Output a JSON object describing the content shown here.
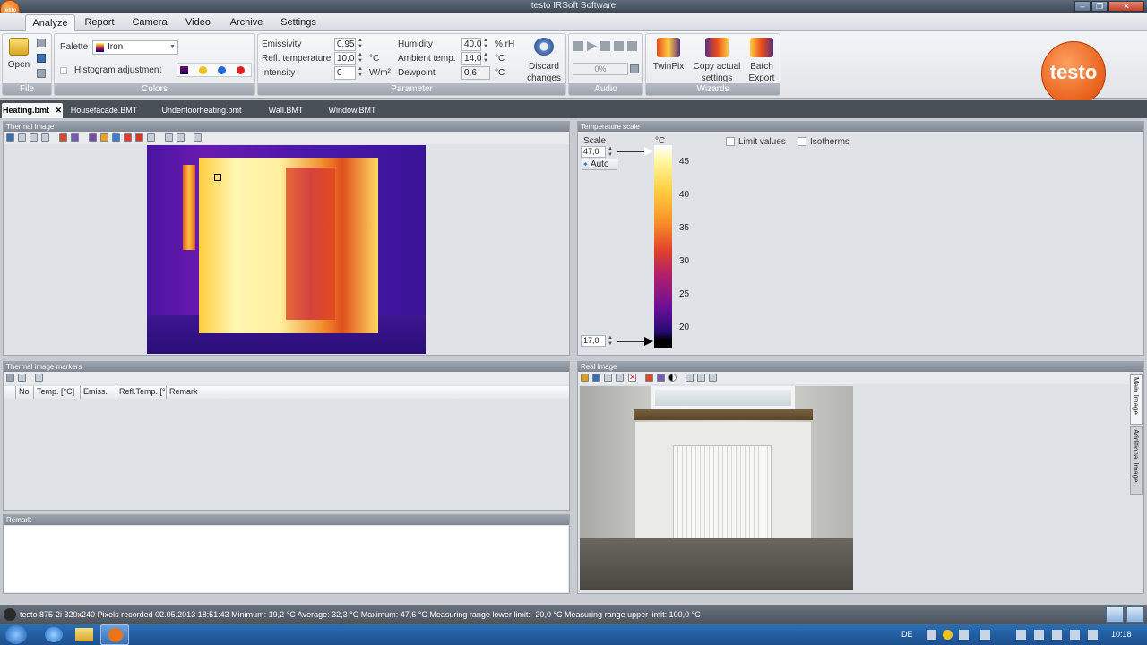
{
  "window": {
    "title": "testo IRSoft Software"
  },
  "menu": {
    "tabs": [
      "Analyze",
      "Report",
      "Camera",
      "Video",
      "Archive",
      "Settings"
    ]
  },
  "ribbon": {
    "file": {
      "label": "File",
      "open_label": "Open"
    },
    "colors": {
      "label": "Colors",
      "palette_label": "Palette",
      "palette_value": "Iron",
      "histogram_label": "Histogram adjustment"
    },
    "parameter": {
      "label": "Parameter",
      "emissivity_label": "Emissivity",
      "emissivity_value": "0,95",
      "refl_temp_label": "Refl. temperature",
      "refl_temp_value": "10,0",
      "refl_temp_unit": "°C",
      "intensity_label": "Intensity",
      "intensity_value": "0",
      "intensity_unit": "W/m²",
      "humidity_label": "Humidity",
      "humidity_value": "40,0",
      "humidity_unit": "% rH",
      "ambient_label": "Ambient temp.",
      "ambient_value": "14,0",
      "ambient_unit": "°C",
      "dewpoint_label": "Dewpoint",
      "dewpoint_value": "0,6",
      "dewpoint_unit": "°C",
      "discard_label_1": "Discard",
      "discard_label_2": "changes"
    },
    "audio": {
      "label": "Audio",
      "progress_text": "0%",
      "progress_fraction": 0
    },
    "wizards": {
      "label": "Wizards",
      "twinpix_label": "TwinPix",
      "copy_label_1": "Copy actual",
      "copy_label_2": "settings",
      "batch_label_1": "Batch",
      "batch_label_2": "Export"
    },
    "brand": "testo"
  },
  "file_tabs": [
    "Heating.bmt",
    "Housefacade.BMT",
    "Underfloorheating.bmt",
    "Wall.BMT",
    "Window.BMT"
  ],
  "panels": {
    "thermal_image": "Thermal image",
    "temperature_scale": "Temperature scale",
    "markers": "Thermal image markers",
    "remark": "Remark",
    "real_image": "Real image"
  },
  "scale": {
    "scale_label": "Scale",
    "unit": "°C",
    "upper_value": "47,0",
    "lower_value": "17,0",
    "auto_label": "Auto",
    "ticks": [
      "45",
      "40",
      "35",
      "30",
      "25",
      "20"
    ],
    "limit_values_label": "Limit values",
    "isotherms_label": "Isotherms"
  },
  "markers_table": {
    "columns": [
      "No",
      "Temp. [°C]",
      "Emiss.",
      "Refl.Temp. [°",
      "Remark"
    ]
  },
  "side_tabs": {
    "main": "Main Image",
    "additional": "Additional Image"
  },
  "status": {
    "text": "testo 875-2i 320x240 Pixels recorded 02.05.2013 18:51:43 Minimum: 19,2 °C Average: 32,3 °C Maximum: 47,6 °C Measuring range lower limit: -20,0 °C Measuring range upper limit: 100,0 °C"
  },
  "taskbar": {
    "language": "DE",
    "clock": "10:18"
  },
  "colors": {
    "accent_orange": "#e8741c",
    "header_gray": "#8a929c"
  }
}
